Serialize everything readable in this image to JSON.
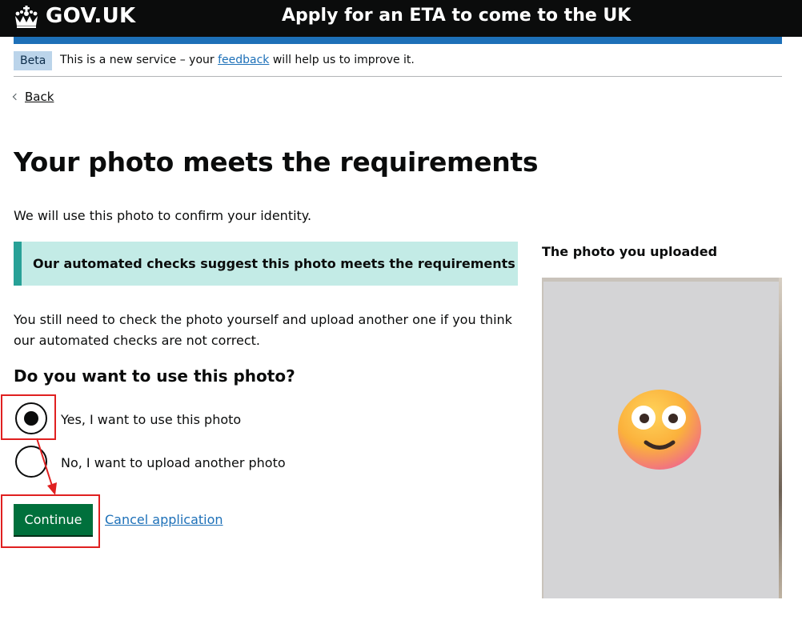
{
  "header": {
    "logo_text": "GOV.UK",
    "service_name": "Apply for an ETA to come to the UK"
  },
  "phase_banner": {
    "tag": "Beta",
    "text_before": "This is a new service – your ",
    "link": "feedback",
    "text_after": " will help us to improve it."
  },
  "back_link": "Back",
  "page": {
    "title": "Your photo meets the requirements",
    "lead": "We will use this photo to confirm your identity.",
    "panel_text": "Our automated checks suggest this photo meets the requirements",
    "body": "You still need to check the photo yourself and upload another one if you think our automated checks are not correct.",
    "question": "Do you want to use this photo?",
    "options": [
      {
        "label": "Yes, I want to use this photo",
        "selected": true
      },
      {
        "label": "No, I want to upload another photo",
        "selected": false
      }
    ],
    "continue_button": "Continue",
    "cancel_link": "Cancel application"
  },
  "photo": {
    "caption": "The photo you uploaded",
    "content": "smiling-face-emoji"
  },
  "colors": {
    "header_bg": "#0b0c0c",
    "brand_blue": "#1d70b8",
    "button_green": "#00703c",
    "panel_bg": "#c3ebe6",
    "panel_border": "#28a197",
    "annotation_red": "#e02020"
  }
}
